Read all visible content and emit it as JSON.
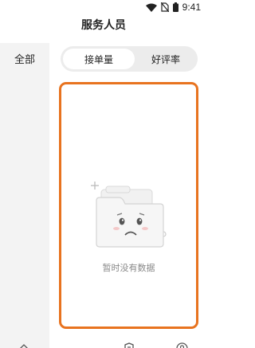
{
  "status_bar": {
    "time": "9:41",
    "icons": [
      "wifi-icon",
      "no-sim-icon",
      "battery-icon"
    ]
  },
  "header": {
    "title": "服务人员"
  },
  "sidebar": {
    "items": [
      {
        "label": "全部",
        "active": true
      }
    ]
  },
  "tabs": [
    {
      "label": "接单量",
      "active": true
    },
    {
      "label": "好评率",
      "active": false
    }
  ],
  "empty_state": {
    "message": "暂时没有数据",
    "icon": "empty-folder-icon"
  },
  "bottom_nav": {
    "items": [
      "home-icon",
      "dot-indicator",
      "shield-icon",
      "profile-icon"
    ],
    "active_color": "#e8731f"
  },
  "colors": {
    "accent": "#e8731f",
    "sidebar_bg": "#f3f3f3",
    "tab_bg": "#ececec"
  }
}
